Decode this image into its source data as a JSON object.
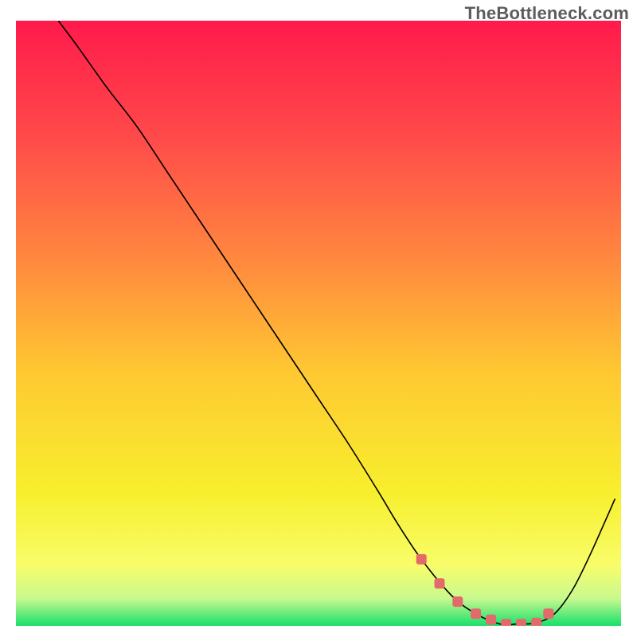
{
  "watermark": "TheBottleneck.com",
  "chart_data": {
    "type": "line",
    "title": "",
    "xlabel": "",
    "ylabel": "",
    "xlim": [
      0,
      100
    ],
    "ylim": [
      0,
      100
    ],
    "grid": false,
    "background_gradient": {
      "direction": "vertical",
      "stops": [
        {
          "offset": 0.0,
          "color": "#ff1a4b"
        },
        {
          "offset": 0.2,
          "color": "#ff4c4a"
        },
        {
          "offset": 0.4,
          "color": "#ff8a3e"
        },
        {
          "offset": 0.58,
          "color": "#ffc832"
        },
        {
          "offset": 0.78,
          "color": "#f7ef2d"
        },
        {
          "offset": 0.9,
          "color": "#f8fd6a"
        },
        {
          "offset": 0.955,
          "color": "#c8f98f"
        },
        {
          "offset": 1.0,
          "color": "#18e06a"
        }
      ]
    },
    "series": [
      {
        "name": "bottleneck-curve",
        "color": "#000000",
        "width": 1.6,
        "x": [
          7,
          10,
          15,
          20,
          25,
          30,
          35,
          40,
          45,
          50,
          55,
          60,
          63,
          67,
          72,
          76,
          80,
          83,
          86,
          89,
          92,
          95,
          99
        ],
        "y": [
          100,
          96,
          89,
          82.5,
          75,
          67.5,
          60,
          52.5,
          45,
          37.5,
          30,
          22,
          17,
          11,
          5,
          2,
          0.3,
          0.3,
          0.5,
          2,
          6,
          12,
          21
        ]
      },
      {
        "name": "optimal-region-markers",
        "type": "scatter",
        "color": "#e26a6a",
        "marker_shape": "rounded-square",
        "marker_size": 13,
        "x": [
          67,
          70,
          73,
          76,
          78.5,
          81,
          83.5,
          86,
          88
        ],
        "y": [
          11,
          7,
          4,
          2,
          1,
          0.3,
          0.3,
          0.5,
          2
        ]
      }
    ]
  }
}
